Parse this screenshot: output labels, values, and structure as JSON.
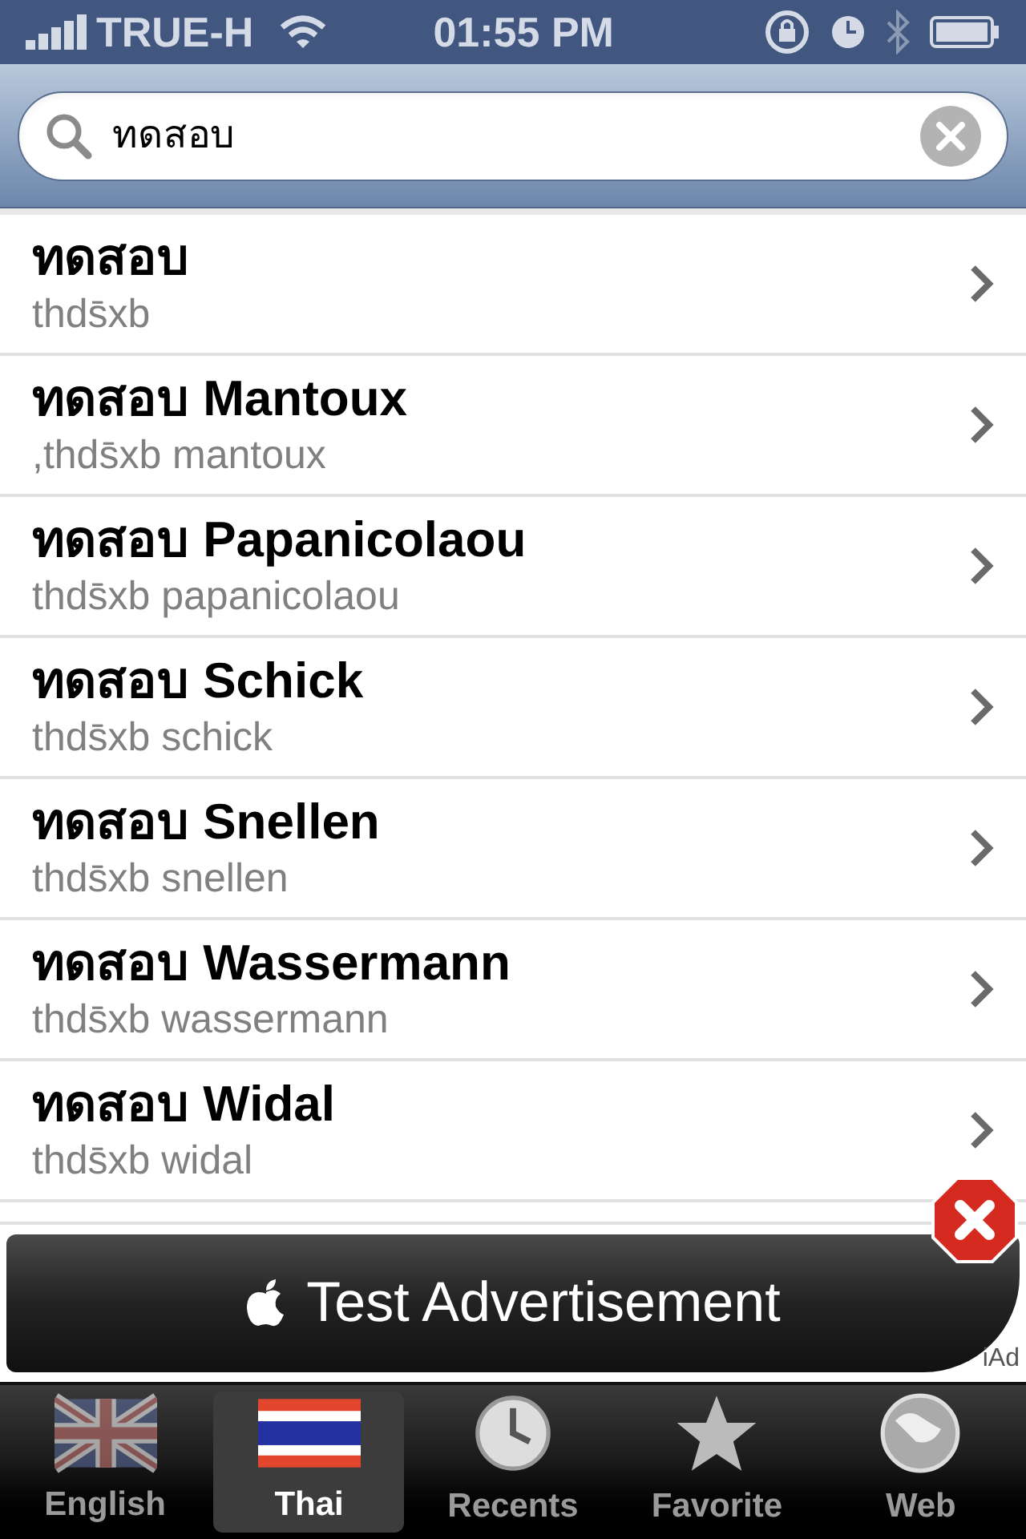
{
  "status_bar": {
    "carrier": "TRUE-H",
    "time": "01:55 PM"
  },
  "search": {
    "value": "ทดสอบ"
  },
  "results": [
    {
      "title": "ทดสอบ",
      "subtitle": "thds̄xb"
    },
    {
      "title": "ทดสอบ Mantoux",
      "subtitle": ",thds̄xb mantoux"
    },
    {
      "title": "ทดสอบ Papanicolaou",
      "subtitle": "thds̄xb papanicolaou"
    },
    {
      "title": "ทดสอบ Schick",
      "subtitle": "thds̄xb schick"
    },
    {
      "title": "ทดสอบ Snellen",
      "subtitle": "thds̄xb snellen"
    },
    {
      "title": "ทดสอบ Wassermann",
      "subtitle": "thds̄xb wassermann"
    },
    {
      "title": "ทดสอบ Widal",
      "subtitle": "thds̄xb widal"
    }
  ],
  "ad": {
    "text": "Test Advertisement",
    "badge": "iAd"
  },
  "tabs": [
    {
      "label": "English",
      "kind": "uk",
      "selected": false
    },
    {
      "label": "Thai",
      "kind": "thai",
      "selected": true
    },
    {
      "label": "Recents",
      "kind": "clock",
      "selected": false
    },
    {
      "label": "Favorite",
      "kind": "star",
      "selected": false
    },
    {
      "label": "Web",
      "kind": "globe",
      "selected": false
    }
  ]
}
